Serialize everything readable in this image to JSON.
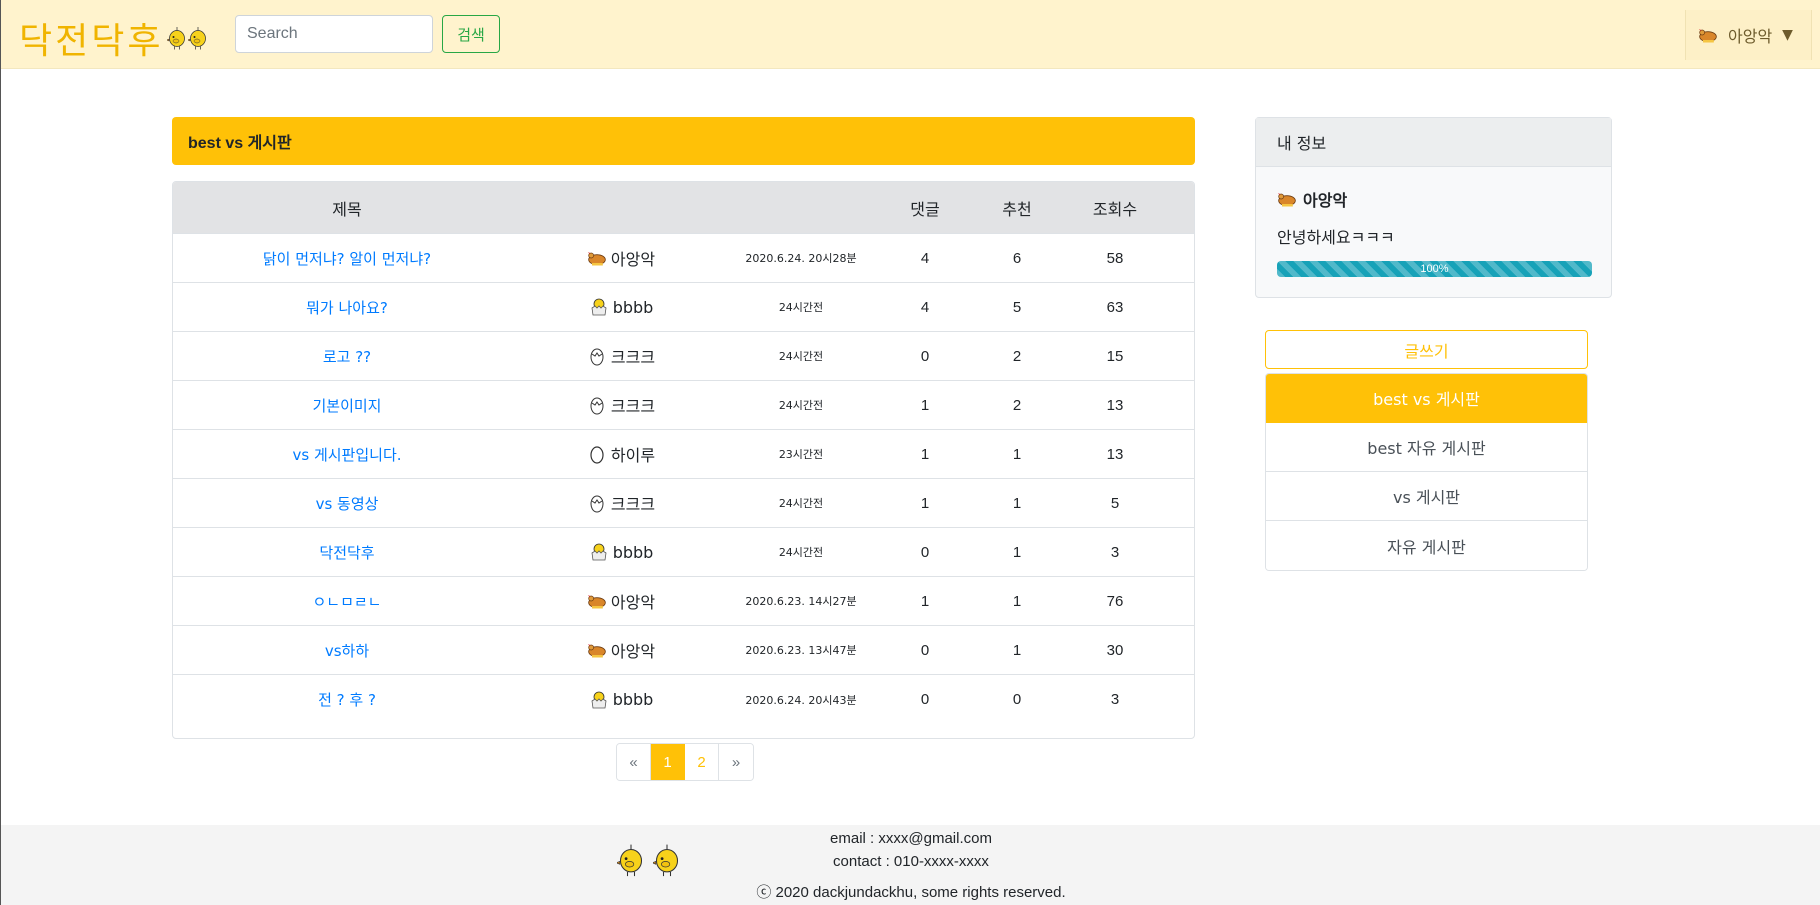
{
  "navbar": {
    "brand": "닥전닥후",
    "search_placeholder": "Search",
    "search_button": "검색",
    "user_name": "아앙악",
    "caret": "▼"
  },
  "board": {
    "title": "best vs 게시판",
    "columns": [
      "제목",
      "",
      "",
      "댓글",
      "추천",
      "조회수"
    ],
    "rows": [
      {
        "title": "닭이 먼저냐? 알이 먼저냐?",
        "avatar": "chicken-icon",
        "author": "아앙악",
        "date": "2020.6.24. 20시28분",
        "comments": "4",
        "recommend": "6",
        "views": "58"
      },
      {
        "title": "뭐가 나아요?",
        "avatar": "hatching-chick-icon",
        "author": "bbbb",
        "date": "24시간전",
        "comments": "4",
        "recommend": "5",
        "views": "63"
      },
      {
        "title": "로고 ??",
        "avatar": "cracked-egg-icon",
        "author": "크크크",
        "date": "24시간전",
        "comments": "0",
        "recommend": "2",
        "views": "15"
      },
      {
        "title": "기본이미지",
        "avatar": "cracked-egg-icon",
        "author": "크크크",
        "date": "24시간전",
        "comments": "1",
        "recommend": "2",
        "views": "13"
      },
      {
        "title": "vs 게시판입니다.",
        "avatar": "egg-icon",
        "author": "하이루",
        "date": "23시간전",
        "comments": "1",
        "recommend": "1",
        "views": "13"
      },
      {
        "title": "vs 동영상",
        "avatar": "cracked-egg-icon",
        "author": "크크크",
        "date": "24시간전",
        "comments": "1",
        "recommend": "1",
        "views": "5"
      },
      {
        "title": "닥전닥후",
        "avatar": "hatching-chick-icon",
        "author": "bbbb",
        "date": "24시간전",
        "comments": "0",
        "recommend": "1",
        "views": "3"
      },
      {
        "title": "ㅇㄴㅁㄹㄴ",
        "avatar": "chicken-icon",
        "author": "아앙악",
        "date": "2020.6.23. 14시27분",
        "comments": "1",
        "recommend": "1",
        "views": "76"
      },
      {
        "title": "vs하하",
        "avatar": "chicken-icon",
        "author": "아앙악",
        "date": "2020.6.23. 13시47분",
        "comments": "0",
        "recommend": "1",
        "views": "30"
      },
      {
        "title": "전 ? 후 ?",
        "avatar": "hatching-chick-icon",
        "author": "bbbb",
        "date": "2020.6.24. 20시43분",
        "comments": "0",
        "recommend": "0",
        "views": "3"
      }
    ]
  },
  "pagination": {
    "prev": "«",
    "pages": [
      "1",
      "2"
    ],
    "current": "1",
    "next": "»"
  },
  "my_info": {
    "header": "내 정보",
    "name": "아앙악",
    "message": "안녕하세요ㅋㅋㅋ",
    "progress_label": "100%",
    "progress_value": 100
  },
  "side": {
    "write_button": "글쓰기",
    "menu": [
      {
        "label": "best vs 게시판",
        "active": true
      },
      {
        "label": "best 자유 게시판",
        "active": false
      },
      {
        "label": "vs 게시판",
        "active": false
      },
      {
        "label": "자유 게시판",
        "active": false
      }
    ]
  },
  "footer": {
    "email": "email : xxxx@gmail.com",
    "contact": "contact : 010-xxxx-xxxx",
    "copyright": "ⓒ 2020 dackjundackhu, some rights reserved."
  },
  "colors": {
    "brand": "#f0b400",
    "accent": "#ffc107",
    "link": "#007bff",
    "success": "#28a745",
    "progress": "#17a2b8"
  }
}
